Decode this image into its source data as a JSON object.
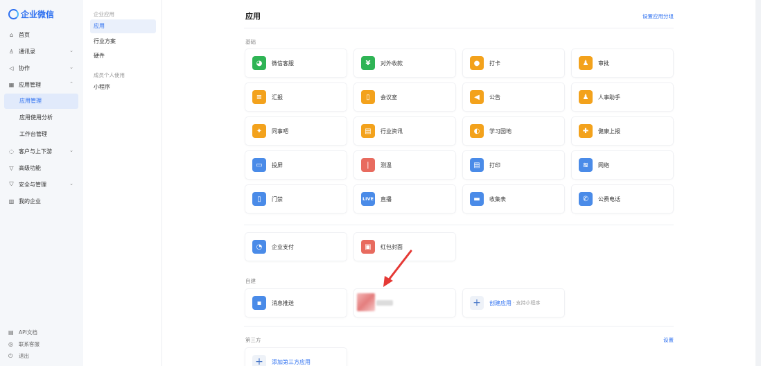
{
  "app": {
    "name": "企业微信"
  },
  "nav": {
    "items": [
      {
        "label": "首页",
        "icon": "home-icon"
      },
      {
        "label": "通讯录",
        "icon": "contacts-icon"
      },
      {
        "label": "协作",
        "icon": "collab-icon"
      },
      {
        "label": "应用管理",
        "icon": "grid-icon"
      }
    ],
    "sub_items": [
      "应用管理",
      "应用使用分析",
      "工作台管理"
    ],
    "items2": [
      {
        "label": "客户与上下游",
        "icon": "chat-icon"
      },
      {
        "label": "高级功能",
        "icon": "diamond-icon"
      },
      {
        "label": "安全与管理",
        "icon": "shield-icon"
      },
      {
        "label": "我的企业",
        "icon": "building-icon"
      }
    ],
    "footer": [
      "API文档",
      "联系客服",
      "退出"
    ]
  },
  "subnav": {
    "group1": "企业应用",
    "items1": [
      "应用",
      "行业方案",
      "硬件"
    ],
    "group2": "成员个人使用",
    "items2": [
      "小程序"
    ]
  },
  "main": {
    "title": "应用",
    "top_link": "设置应用分组",
    "sections": {
      "basic": "基础",
      "custom": "自建",
      "third": "第三方",
      "third_link": "设置"
    },
    "basic_apps": [
      {
        "name": "微信客服",
        "icon": "wechat-service-icon",
        "color": "#2fb455"
      },
      {
        "name": "对外收款",
        "icon": "yen-icon",
        "color": "#2fb455"
      },
      {
        "name": "打卡",
        "icon": "location-pin-icon",
        "color": "#f3a21c"
      },
      {
        "name": "审批",
        "icon": "approval-icon",
        "color": "#f3a21c"
      },
      {
        "name": "汇报",
        "icon": "report-icon",
        "color": "#f3a21c"
      },
      {
        "name": "会议室",
        "icon": "meeting-room-icon",
        "color": "#f3a21c"
      },
      {
        "name": "公告",
        "icon": "megaphone-icon",
        "color": "#f3a21c"
      },
      {
        "name": "人事助手",
        "icon": "person-icon",
        "color": "#f3a21c"
      },
      {
        "name": "同事吧",
        "icon": "diamond-dots-icon",
        "color": "#f3a21c"
      },
      {
        "name": "行业资讯",
        "icon": "news-icon",
        "color": "#f3a21c"
      },
      {
        "name": "学习园地",
        "icon": "planet-icon",
        "color": "#f3a21c"
      },
      {
        "name": "健康上报",
        "icon": "health-icon",
        "color": "#f3a21c"
      },
      {
        "name": "投屏",
        "icon": "cast-icon",
        "color": "#4a8be8"
      },
      {
        "name": "测温",
        "icon": "thermometer-icon",
        "color": "#e86b5f"
      },
      {
        "name": "打印",
        "icon": "printer-icon",
        "color": "#4a8be8"
      },
      {
        "name": "网络",
        "icon": "network-icon",
        "color": "#4a8be8"
      },
      {
        "name": "门禁",
        "icon": "door-icon",
        "color": "#4a8be8"
      },
      {
        "name": "直播",
        "icon": "live-icon",
        "color": "#4a8be8",
        "glyph": "LIVE"
      },
      {
        "name": "收集表",
        "icon": "form-icon",
        "color": "#4a8be8"
      },
      {
        "name": "公费电话",
        "icon": "phone-icon",
        "color": "#4a8be8"
      }
    ],
    "extra_apps": [
      {
        "name": "企业支付",
        "icon": "payment-icon",
        "color": "#4a8be8"
      },
      {
        "name": "红包封面",
        "icon": "red-packet-icon",
        "color": "#e86b5f"
      }
    ],
    "custom_apps": [
      {
        "name": "消息推送",
        "icon": "message-push-icon",
        "color": "#4a8be8"
      }
    ],
    "create_app": {
      "label": "创建应用",
      "sub": "· 支持小程序"
    },
    "add_third": {
      "label": "添加第三方应用"
    }
  }
}
